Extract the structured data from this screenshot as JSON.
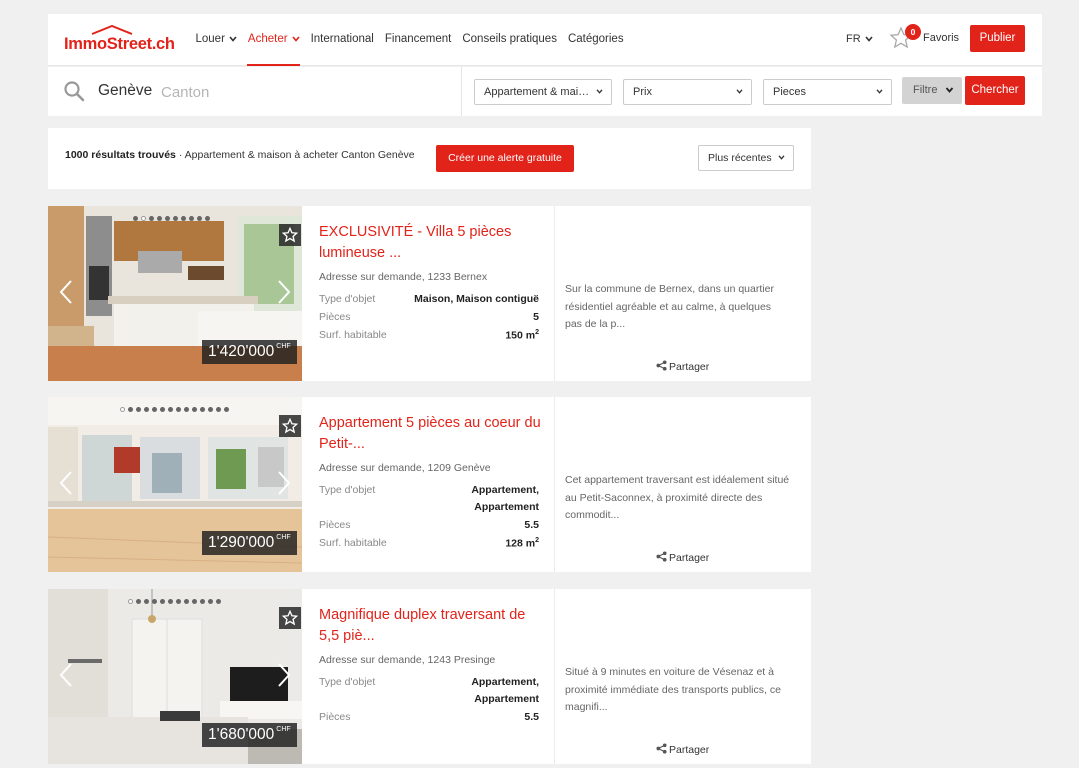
{
  "header": {
    "logo_text": "ImmoStreet.ch",
    "nav": [
      {
        "label": "Louer",
        "has_caret": true
      },
      {
        "label": "Acheter",
        "has_caret": true,
        "active": true
      },
      {
        "label": "International"
      },
      {
        "label": "Financement"
      },
      {
        "label": "Conseils pratiques"
      },
      {
        "label": "Catégories"
      }
    ],
    "lang": "FR",
    "favorites_count": "0",
    "favorites_label": "Favoris",
    "publish_label": "Publier"
  },
  "search": {
    "city": "Genève",
    "placeholder": "Canton",
    "type_select": "Appartement & mai…",
    "price_select": "Prix",
    "rooms_select": "Pieces",
    "filter_label": "Filtre",
    "search_label": "Chercher"
  },
  "results": {
    "count": "1000 résultats trouvés",
    "description": " · Appartement & maison à acheter Canton Genève",
    "alert_label": "Créer une alerte gratuite",
    "sort_label": "Plus récentes"
  },
  "listings": [
    {
      "price": "1'420'000",
      "currency": "CHF",
      "title": "EXCLUSIVITÉ - Villa 5 pièces lumineuse ...",
      "address": "Adresse sur demande, 1233 Bernex",
      "type_label": "Type d'objet",
      "type_value": "Maison, Maison contiguë",
      "rooms_label": "Pièces",
      "rooms_value": "5",
      "surface_label": "Surf. habitable",
      "surface_value": "150 m",
      "surface_unit_sup": "2",
      "description": "Sur la commune de Bernex, dans un quartier résidentiel agréable et au calme, à quelques pas de la p...",
      "share_label": "Partager"
    },
    {
      "price": "1'290'000",
      "currency": "CHF",
      "title": "Appartement 5 pièces au coeur du Petit-...",
      "address": "Adresse sur demande, 1209 Genève",
      "type_label": "Type d'objet",
      "type_value_1": "Appartement,",
      "type_value_2": "Appartement",
      "rooms_label": "Pièces",
      "rooms_value": "5.5",
      "surface_label": "Surf. habitable",
      "surface_value": "128 m",
      "surface_unit_sup": "2",
      "description": "Cet appartement traversant est idéalement situé au Petit-Saconnex, à proximité directe des commodit...",
      "share_label": "Partager"
    },
    {
      "price": "1'680'000",
      "currency": "CHF",
      "title": "Magnifique duplex traversant de 5,5 piè...",
      "address": "Adresse sur demande, 1243 Presinge",
      "type_label": "Type d'objet",
      "type_value_1": "Appartement,",
      "type_value_2": "Appartement",
      "rooms_label": "Pièces",
      "rooms_value": "5.5",
      "description": "Situé à 9 minutes en voiture de Vésenaz et à proximité immédiate des transports publics, ce magnifi...",
      "share_label": "Partager"
    }
  ],
  "colors": {
    "brand": "#e2231a",
    "background": "#f0f0f0"
  },
  "icons": [
    "logo-roof-icon",
    "chevron-down-icon",
    "star-icon",
    "search-icon",
    "arrow-left-icon",
    "arrow-right-icon",
    "share-icon"
  ]
}
